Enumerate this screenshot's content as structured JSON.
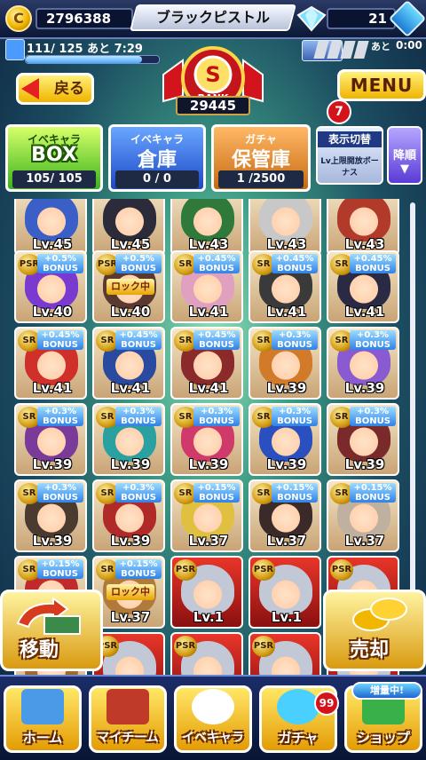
{
  "header": {
    "coins": "2796388",
    "title": "ブラックピストル",
    "gems": "21",
    "stamina_text": "111/ 125 あと 7:29",
    "stamina_current": 111,
    "stamina_max": 125,
    "timer_label": "あと",
    "timer": "0:00"
  },
  "rank": {
    "letter": "S",
    "label": "RANK",
    "score": "29445"
  },
  "buttons": {
    "back": "戻る",
    "menu": "MENU"
  },
  "menu_badge": "7",
  "tabs": [
    {
      "title": "イベキャラ",
      "big": "BOX",
      "count": "105/ 105"
    },
    {
      "title": "イベキャラ",
      "big": "倉庫",
      "count": "0 / 0"
    },
    {
      "title": "ガチャ",
      "big": "保管庫",
      "count": "1 /2500"
    }
  ],
  "display": {
    "label": "表示切替",
    "value": "Lv上限開放ボーナス",
    "sort": "降順"
  },
  "cards": [
    {
      "rarity": "",
      "bonus": "",
      "lv": "Lv.45",
      "lock": "",
      "color": "#3a60c8"
    },
    {
      "rarity": "",
      "bonus": "",
      "lv": "Lv.45",
      "lock": "",
      "color": "#2b2b3a"
    },
    {
      "rarity": "",
      "bonus": "",
      "lv": "Lv.43",
      "lock": "",
      "color": "#2f7a3a"
    },
    {
      "rarity": "",
      "bonus": "",
      "lv": "Lv.43",
      "lock": "",
      "color": "#c8c8c8"
    },
    {
      "rarity": "",
      "bonus": "",
      "lv": "Lv.43",
      "lock": "",
      "color": "#b23a2a"
    },
    {
      "rarity": "PSR",
      "bonus": "+0.5%\nBONUS",
      "lv": "Lv.40",
      "lock": "",
      "color": "#7a3ad0"
    },
    {
      "rarity": "PSR",
      "bonus": "+0.5%\nBONUS",
      "lv": "Lv.40",
      "lock": "ロック中",
      "color": "#5a3a30"
    },
    {
      "rarity": "SR",
      "bonus": "+0.45%\nBONUS",
      "lv": "Lv.41",
      "lock": "",
      "color": "#e0a0c0"
    },
    {
      "rarity": "SR",
      "bonus": "+0.45%\nBONUS",
      "lv": "Lv.41",
      "lock": "",
      "color": "#3a3a3a"
    },
    {
      "rarity": "SR",
      "bonus": "+0.45%\nBONUS",
      "lv": "Lv.41",
      "lock": "",
      "color": "#2a2a44"
    },
    {
      "rarity": "SR",
      "bonus": "+0.45%\nBONUS",
      "lv": "Lv.41",
      "lock": "",
      "color": "#d0302a"
    },
    {
      "rarity": "SR",
      "bonus": "+0.45%\nBONUS",
      "lv": "Lv.41",
      "lock": "",
      "color": "#2a4aa0"
    },
    {
      "rarity": "SR",
      "bonus": "+0.45%\nBONUS",
      "lv": "Lv.41",
      "lock": "",
      "color": "#8a2a2a"
    },
    {
      "rarity": "SR",
      "bonus": "+0.3%\nBONUS",
      "lv": "Lv.39",
      "lock": "",
      "color": "#d07a2a"
    },
    {
      "rarity": "SR",
      "bonus": "+0.3%\nBONUS",
      "lv": "Lv.39",
      "lock": "",
      "color": "#8a5ad0"
    },
    {
      "rarity": "SR",
      "bonus": "+0.3%\nBONUS",
      "lv": "Lv.39",
      "lock": "",
      "color": "#7a3a9a"
    },
    {
      "rarity": "SR",
      "bonus": "+0.3%\nBONUS",
      "lv": "Lv.39",
      "lock": "",
      "color": "#2aa0a0"
    },
    {
      "rarity": "SR",
      "bonus": "+0.3%\nBONUS",
      "lv": "Lv.39",
      "lock": "",
      "color": "#d03a6a"
    },
    {
      "rarity": "SR",
      "bonus": "+0.3%\nBONUS",
      "lv": "Lv.39",
      "lock": "",
      "color": "#2a50c0"
    },
    {
      "rarity": "SR",
      "bonus": "+0.3%\nBONUS",
      "lv": "Lv.39",
      "lock": "",
      "color": "#7a2a2a"
    },
    {
      "rarity": "SR",
      "bonus": "+0.3%\nBONUS",
      "lv": "Lv.39",
      "lock": "",
      "color": "#4a3a30"
    },
    {
      "rarity": "SR",
      "bonus": "+0.3%\nBONUS",
      "lv": "Lv.39",
      "lock": "",
      "color": "#b02a2a"
    },
    {
      "rarity": "SR",
      "bonus": "+0.15%\nBONUS",
      "lv": "Lv.37",
      "lock": "",
      "color": "#e0c040"
    },
    {
      "rarity": "SR",
      "bonus": "+0.15%\nBONUS",
      "lv": "Lv.37",
      "lock": "",
      "color": "#3a2a2a"
    },
    {
      "rarity": "SR",
      "bonus": "+0.15%\nBONUS",
      "lv": "Lv.37",
      "lock": "",
      "color": "#c0b0a0"
    },
    {
      "rarity": "SR",
      "bonus": "+0.15%\nBONUS",
      "lv": "",
      "lock": "",
      "color": "#c02a2a"
    },
    {
      "rarity": "SR",
      "bonus": "+0.15%\nBONUS",
      "lv": "Lv.37",
      "lock": "ロック中",
      "color": "#b07a3a"
    },
    {
      "rarity": "PSR",
      "bonus": "",
      "lv": "Lv.1",
      "lock": "",
      "color": "#c2c8d6"
    },
    {
      "rarity": "PSR",
      "bonus": "",
      "lv": "Lv.1",
      "lock": "",
      "color": "#c2c8d6"
    },
    {
      "rarity": "PSR",
      "bonus": "",
      "lv": "",
      "lock": "",
      "color": "#c2c8d6"
    },
    {
      "rarity": "",
      "bonus": "",
      "lv": "",
      "lock": "",
      "color": "#a06a2a"
    },
    {
      "rarity": "PSR",
      "bonus": "",
      "lv": "",
      "lock": "",
      "color": "#c2c8d6"
    },
    {
      "rarity": "PSR",
      "bonus": "",
      "lv": "",
      "lock": "",
      "color": "#c2c8d6"
    },
    {
      "rarity": "PSR",
      "bonus": "",
      "lv": "",
      "lock": "",
      "color": "#c2c8d6"
    },
    {
      "rarity": "PSR",
      "bonus": "",
      "lv": "",
      "lock": "",
      "color": "#c2c8d6"
    }
  ],
  "actions": {
    "move": "移動",
    "sell": "売却"
  },
  "nav": [
    {
      "label": "ホーム",
      "art_color": "#4a9ae8"
    },
    {
      "label": "マイチーム",
      "art_color": "#c03a2a"
    },
    {
      "label": "イベキャラ",
      "art_color": "#ffffff"
    },
    {
      "label": "ガチャ",
      "art_color": "#4ad0ff"
    },
    {
      "label": "ショップ",
      "art_color": "#3ab04a"
    }
  ],
  "gacha_badge": "99",
  "shop_badge": "増量中!"
}
